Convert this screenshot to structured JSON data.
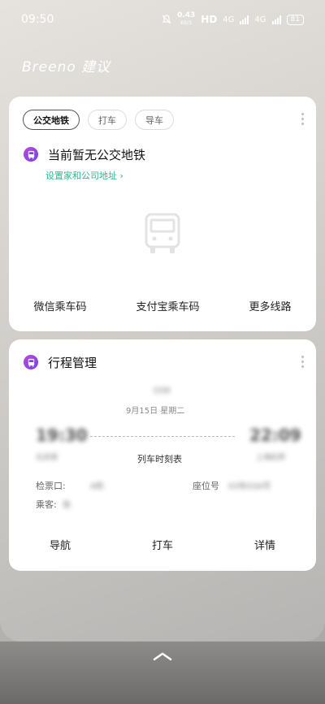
{
  "status": {
    "time": "09:50",
    "speed": "0.43",
    "speed_unit": "KB/S",
    "hd": "HD",
    "net1": "4G",
    "net2": "4G",
    "battery": "81"
  },
  "header": {
    "title": "Breeno 建议"
  },
  "transit_card": {
    "chips": [
      "公交地铁",
      "打车",
      "导车"
    ],
    "heading": "当前暂无公交地铁",
    "setup_link": "设置家和公司地址 ›",
    "actions": [
      "微信乘车码",
      "支付宝乘车码",
      "更多线路"
    ]
  },
  "trip_card": {
    "heading": "行程管理",
    "train_no": "G58",
    "date": "9月15日 星期二",
    "depart_time": "19:30",
    "arrive_time": "22:09",
    "depart_station": "北京南",
    "arrive_station": "上海虹桥",
    "timetable_label": "列车时刻表",
    "gate_label": "检票口:",
    "gate_value": "A检",
    "seat_label": "座位号",
    "seat_value": "03车03A号",
    "passenger_label": "乘客:",
    "passenger_value": "张",
    "actions": [
      "导航",
      "打车",
      "详情"
    ]
  },
  "colors": {
    "accent_purple": "#8a3fe0",
    "link_green": "#2fb58f"
  },
  "icons": [
    "bell-icon",
    "bus-icon",
    "chevron-up-icon",
    "more-icon"
  ]
}
